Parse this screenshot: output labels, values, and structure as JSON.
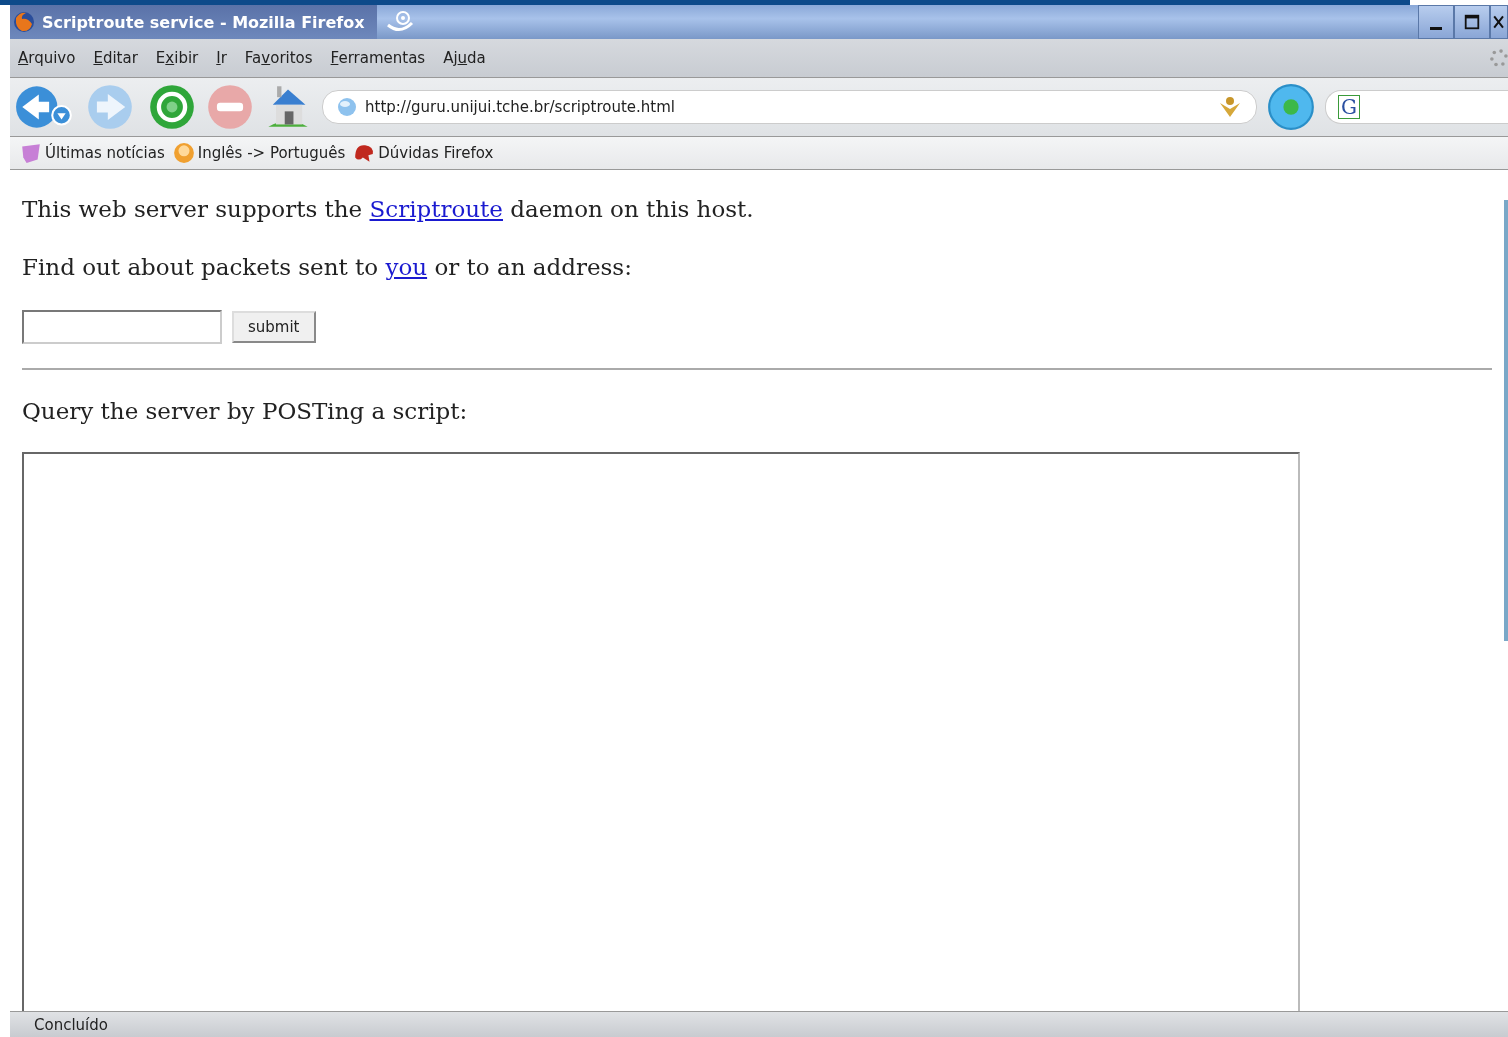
{
  "window": {
    "title": "Scriptroute service - Mozilla Firefox"
  },
  "menu": [
    {
      "key": "A",
      "after": "rquivo"
    },
    {
      "key": "E",
      "after": "ditar"
    },
    {
      "before": "E",
      "key": "x",
      "after": "ibir"
    },
    {
      "key": "I",
      "after": "r"
    },
    {
      "before": "Fa",
      "key": "v",
      "after": "oritos"
    },
    {
      "key": "F",
      "after": "erramentas"
    },
    {
      "before": "Aj",
      "key": "u",
      "after": "da"
    }
  ],
  "toolbar": {
    "address": "http://guru.unijui.tche.br/scriptroute.html",
    "search_logo": "G"
  },
  "bookmarks": [
    {
      "label": "Últimas notícias",
      "kind": "news"
    },
    {
      "label": "Inglês -> Português",
      "kind": "translate"
    },
    {
      "label": "Dúvidas Firefox",
      "kind": "help"
    }
  ],
  "page": {
    "line1": {
      "before": "This web server supports the ",
      "link": "Scriptroute",
      "after": " daemon on this host."
    },
    "line2": {
      "before": "Find out about packets sent to ",
      "link": "you",
      "after": " or to an address:"
    },
    "submit": "submit",
    "line3": "Query the server by POSTing a script:"
  },
  "status_bar": "Concluído"
}
